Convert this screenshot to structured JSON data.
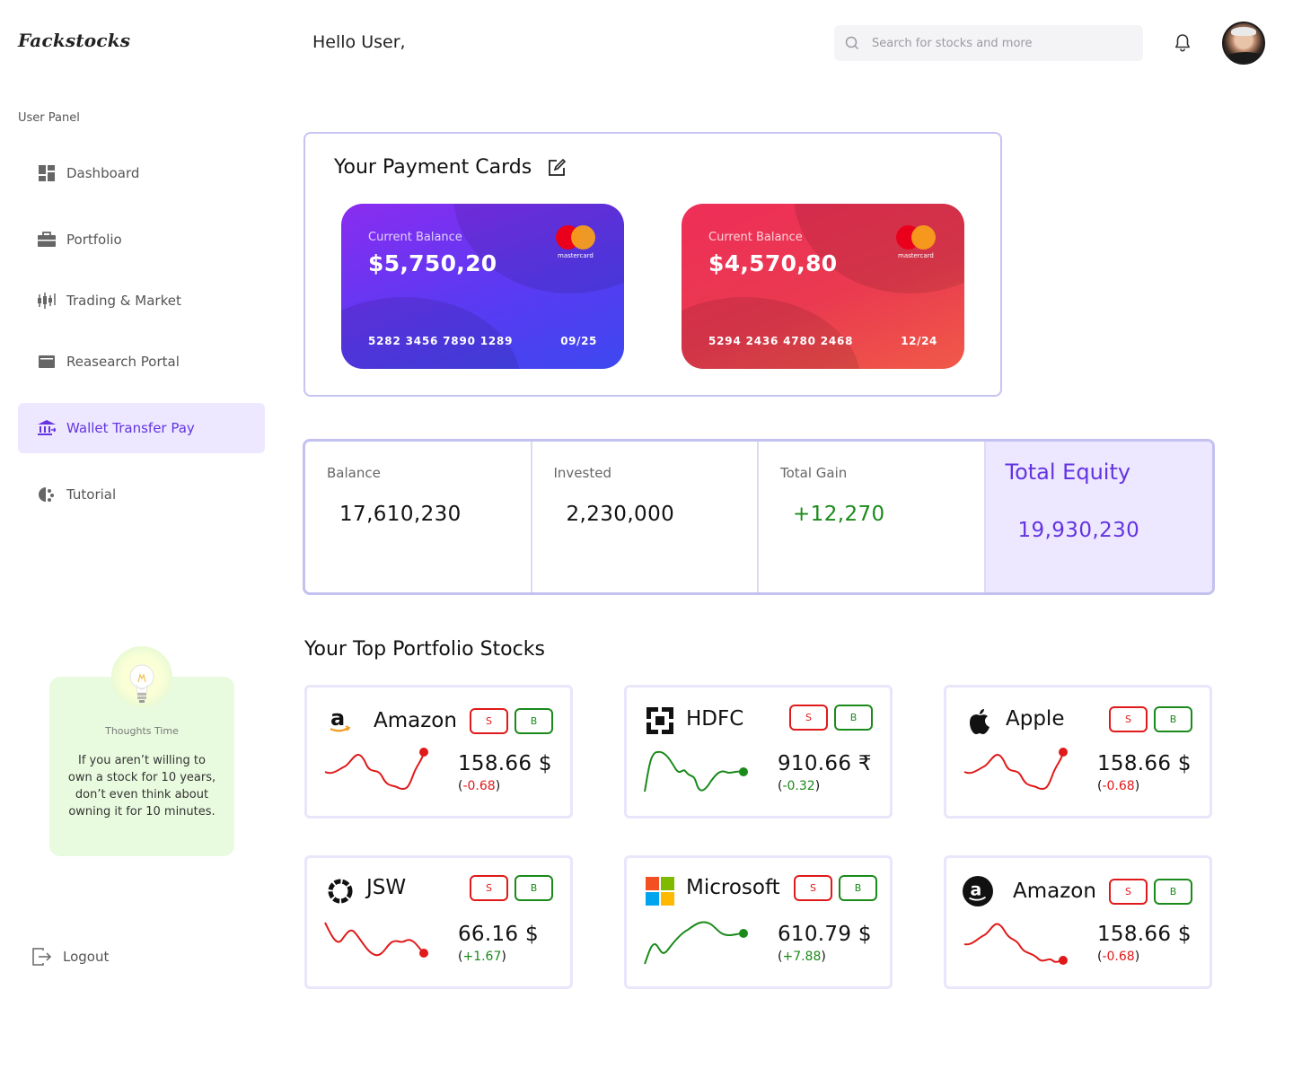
{
  "app": {
    "logo": "Fackstocks",
    "greeting": "Hello User,"
  },
  "search": {
    "placeholder": "Search for stocks and more"
  },
  "sidebar": {
    "title": "User Panel",
    "items": [
      {
        "label": "Dashboard",
        "icon": "dashboard-icon"
      },
      {
        "label": "Portfolio",
        "icon": "briefcase-icon"
      },
      {
        "label": "Trading & Market",
        "icon": "candlestick-icon"
      },
      {
        "label": "Reasearch Portal",
        "icon": "research-icon"
      },
      {
        "label": "Wallet Transfer Pay",
        "icon": "bank-icon",
        "active": true
      },
      {
        "label": "Tutorial",
        "icon": "tutorial-icon"
      }
    ],
    "logout": "Logout"
  },
  "thought": {
    "title": "Thoughts Time",
    "text": "If you aren’t willing to own a stock for 10 years, don’t even think about owning it for 10 minutes."
  },
  "payment_cards": {
    "title": "Your Payment Cards",
    "cards": [
      {
        "label": "Current Balance",
        "amount": "$5,750,20",
        "number": "5282 3456 7890 1289",
        "expiry": "09/25",
        "brand": "mastercard"
      },
      {
        "label": "Current Balance",
        "amount": "$4,570,80",
        "number": "5294 2436 4780 2468",
        "expiry": "12/24",
        "brand": "mastercard"
      }
    ]
  },
  "summary": {
    "balance": {
      "label": "Balance",
      "value": "17,610,230"
    },
    "invested": {
      "label": "Invested",
      "value": "2,230,000"
    },
    "gain": {
      "label": "Total Gain",
      "value": "+12,270"
    },
    "equity": {
      "label": "Total Equity",
      "value": "19,930,230"
    }
  },
  "stocks": {
    "title": "Your Top Portfolio Stocks",
    "sell_label": "S",
    "buy_label": "B",
    "items": [
      {
        "name": "Amazon",
        "logo": "amazon-icon",
        "price": "158.66 $",
        "change": "-0.68",
        "trend": "down",
        "color": "#e01a1a"
      },
      {
        "name": "HDFC",
        "logo": "hdfc-icon",
        "price": "910.66 ₹",
        "change": "-0.32",
        "trend": "up",
        "color": "#1a8a1a"
      },
      {
        "name": "Apple",
        "logo": "apple-icon",
        "price": "158.66 $",
        "change": "-0.68",
        "trend": "down",
        "color": "#e01a1a"
      },
      {
        "name": "JSW",
        "logo": "jsw-icon",
        "price": "66.16 $",
        "change": "+1.67",
        "trend": "down",
        "color": "#e01a1a"
      },
      {
        "name": "Microsoft",
        "logo": "microsoft-icon",
        "price": "610.79 $",
        "change": "+7.88",
        "trend": "up",
        "color": "#1a8a1a"
      },
      {
        "name": "Amazon",
        "logo": "amazon-circle-icon",
        "price": "158.66 $",
        "change": "-0.68",
        "trend": "down",
        "color": "#e01a1a"
      }
    ]
  }
}
